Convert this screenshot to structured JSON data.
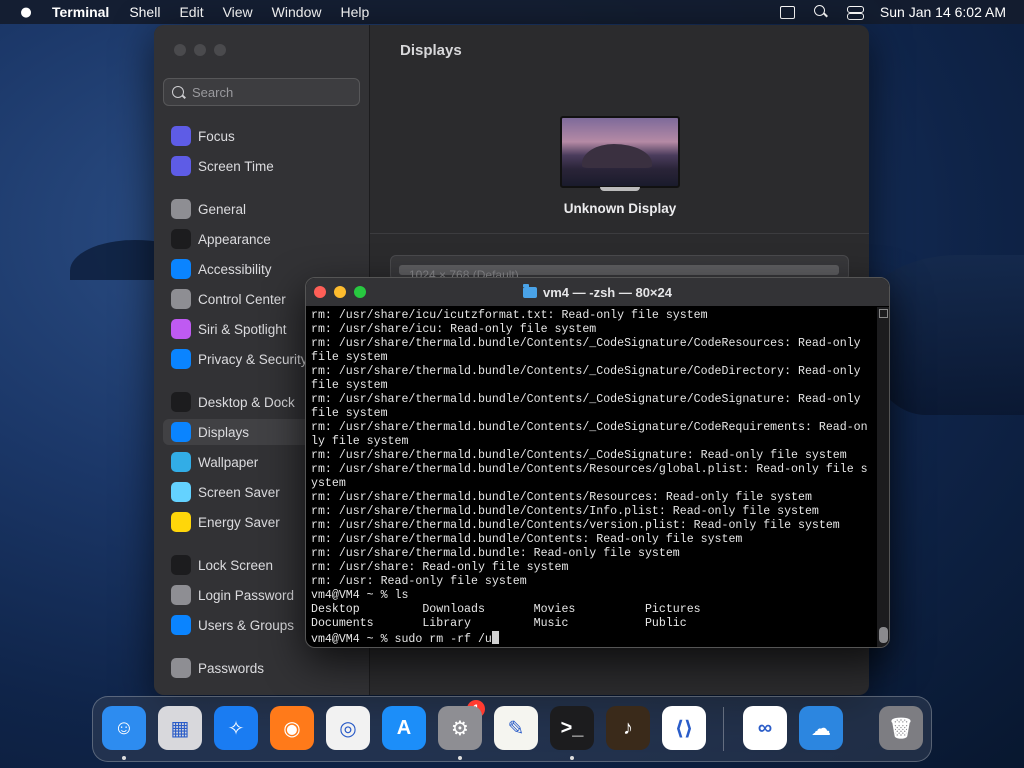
{
  "menubar": {
    "app_name": "Terminal",
    "menus": [
      "Shell",
      "Edit",
      "View",
      "Window",
      "Help"
    ],
    "clock": "Sun Jan 14  6:02 AM"
  },
  "settings": {
    "search_placeholder": "Search",
    "content_title": "Displays",
    "display_name": "Unknown Display",
    "resolution_text": "1024 × 768 (Default)",
    "sidebar_items": [
      {
        "label": "Focus",
        "color": "#5e5ce6"
      },
      {
        "label": "Screen Time",
        "color": "#5e5ce6"
      },
      {
        "label": "General",
        "color": "#8e8e93"
      },
      {
        "label": "Appearance",
        "color": "#1c1c1e"
      },
      {
        "label": "Accessibility",
        "color": "#0a84ff"
      },
      {
        "label": "Control Center",
        "color": "#8e8e93"
      },
      {
        "label": "Siri & Spotlight",
        "color": "#bf5af2"
      },
      {
        "label": "Privacy & Security",
        "color": "#0a84ff"
      },
      {
        "label": "Desktop & Dock",
        "color": "#1c1c1e"
      },
      {
        "label": "Displays",
        "color": "#0a84ff"
      },
      {
        "label": "Wallpaper",
        "color": "#32ade6"
      },
      {
        "label": "Screen Saver",
        "color": "#64d2ff"
      },
      {
        "label": "Energy Saver",
        "color": "#ffd60a"
      },
      {
        "label": "Lock Screen",
        "color": "#1c1c1e"
      },
      {
        "label": "Login Password",
        "color": "#8e8e93"
      },
      {
        "label": "Users & Groups",
        "color": "#0a84ff"
      },
      {
        "label": "Passwords",
        "color": "#8e8e93"
      }
    ]
  },
  "terminal": {
    "title": "vm4 — -zsh — 80×24",
    "lines": [
      "rm: /usr/share/icu/icutzformat.txt: Read-only file system",
      "rm: /usr/share/icu: Read-only file system",
      "rm: /usr/share/thermald.bundle/Contents/_CodeSignature/CodeResources: Read-only",
      "file system",
      "rm: /usr/share/thermald.bundle/Contents/_CodeSignature/CodeDirectory: Read-only",
      "file system",
      "rm: /usr/share/thermald.bundle/Contents/_CodeSignature/CodeSignature: Read-only",
      "file system",
      "rm: /usr/share/thermald.bundle/Contents/_CodeSignature/CodeRequirements: Read-on",
      "ly file system",
      "rm: /usr/share/thermald.bundle/Contents/_CodeSignature: Read-only file system",
      "rm: /usr/share/thermald.bundle/Contents/Resources/global.plist: Read-only file s",
      "ystem",
      "rm: /usr/share/thermald.bundle/Contents/Resources: Read-only file system",
      "rm: /usr/share/thermald.bundle/Contents/Info.plist: Read-only file system",
      "rm: /usr/share/thermald.bundle/Contents/version.plist: Read-only file system",
      "rm: /usr/share/thermald.bundle/Contents: Read-only file system",
      "rm: /usr/share/thermald.bundle: Read-only file system",
      "rm: /usr/share: Read-only file system",
      "rm: /usr: Read-only file system",
      "vm4@VM4 ~ % ls",
      "Desktop         Downloads       Movies          Pictures",
      "Documents       Library         Music           Public"
    ],
    "prompt": "vm4@VM4 ~ % sudo rm -rf /u"
  },
  "dock": {
    "badge": "1",
    "apps": [
      {
        "name": "finder",
        "color": "#2d8cf0",
        "glyph": "☺",
        "running": true
      },
      {
        "name": "launchpad",
        "color": "#d8d8dc",
        "glyph": "▦",
        "running": false
      },
      {
        "name": "safari",
        "color": "#1a7cf2",
        "glyph": "✧",
        "running": false
      },
      {
        "name": "firefox",
        "color": "#ff7a1a",
        "glyph": "◉",
        "running": false
      },
      {
        "name": "chrome",
        "color": "#f2f2f2",
        "glyph": "◎",
        "running": false
      },
      {
        "name": "app-store",
        "color": "#1c8ef9",
        "glyph": "A",
        "running": false
      },
      {
        "name": "system-settings",
        "color": "#8e8e93",
        "glyph": "⚙",
        "running": true
      },
      {
        "name": "textedit",
        "color": "#f5f5f0",
        "glyph": "✎",
        "running": false
      },
      {
        "name": "terminal",
        "color": "#1c1c1e",
        "glyph": ">_",
        "running": true
      },
      {
        "name": "garageband",
        "color": "#3a2a1a",
        "glyph": "♪",
        "running": false
      },
      {
        "name": "vscode",
        "color": "#ffffff",
        "glyph": "⟨⟩",
        "running": false
      },
      {
        "name": "visual-studio",
        "color": "#ffffff",
        "glyph": "∞",
        "running": false
      },
      {
        "name": "weather",
        "color": "#2c86e0",
        "glyph": "☁",
        "running": false
      },
      {
        "name": "trash",
        "color": "#7d7d82",
        "glyph": "🗑",
        "running": false
      }
    ]
  }
}
